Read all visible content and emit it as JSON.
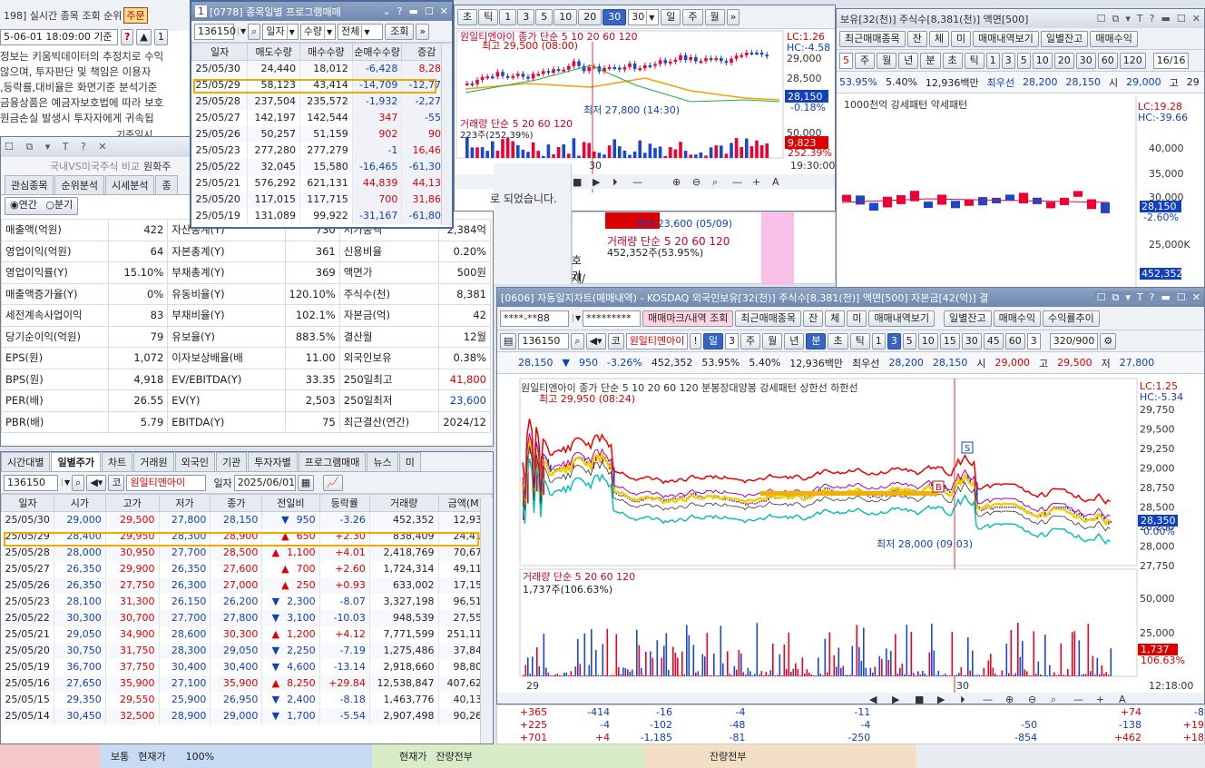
{
  "realtime": {
    "title_prefix": "198] 실시간 종목 조회 순위",
    "tab_label": "주문",
    "date_input": "5-06-01 18:09:00 기준",
    "notice": [
      "정보는 키움빅데이터의 추정치로 수익",
      "않으며, 투자판단 및 책임은 이용자",
      ",등락률,대비율은 화면기준 분석기준",
      "금융상품은 예금자보호법에 따라 보호",
      "원금손실 발생시 투자자에게 귀속됩"
    ]
  },
  "compare": {
    "title": "국내VS미국주식 비교",
    "title_suffix": "원화주",
    "tabs": [
      "관심종목",
      "순위분석",
      "시세분석",
      "종"
    ],
    "radio_annual": "연간",
    "radio_quarter": "분기",
    "rows": [
      [
        "매출액(억원)",
        "422",
        "자산총계(Y)",
        "730",
        "시가총액",
        "2,384억"
      ],
      [
        "영업이익(억원)",
        "64",
        "자본총계(Y)",
        "361",
        "신용비율",
        "0.20%"
      ],
      [
        "영업이익률(Y)",
        "15.10%",
        "부채총계(Y)",
        "369",
        "액면가",
        "500원"
      ],
      [
        "매출액증가율(Y)",
        "0%",
        "유동비율(Y)",
        "120.10%",
        "주식수(천)",
        "8,381"
      ],
      [
        "세전계속사업이익",
        "83",
        "부채비율(Y)",
        "102.1%",
        "자본금(억)",
        "42"
      ],
      [
        "당기순이익(억원)",
        "79",
        "유보율(Y)",
        "883.5%",
        "결산월",
        "12월"
      ],
      [
        "EPS(원)",
        "1,072",
        "이자보상배율(배",
        "11.00",
        "외국인보유",
        "0.38%"
      ],
      [
        "BPS(원)",
        "4,918",
        "EV/EBITDA(Y)",
        "33.35",
        "250일최고",
        "41,800"
      ],
      [
        "PER(배)",
        "26.55",
        "EV(Y)",
        "2,503",
        "250일최저",
        "23,600"
      ],
      [
        "PBR(배)",
        "5.79",
        "EBITDA(Y)",
        "75",
        "최근결산(연간)",
        "2024/12"
      ]
    ],
    "date_label": "기준일시",
    "other_label": "기"
  },
  "program": {
    "title": "[0778] 종목일별 프로그램매매",
    "code": "136150",
    "select1": "일자",
    "select2": "수량",
    "select3": "전체",
    "query": "조회",
    "headers": [
      "일자",
      "매도수량",
      "매수수량",
      "순매수수량",
      "증감"
    ],
    "rows": [
      [
        "25/05/30",
        "24,440",
        "18,012",
        "-6,428",
        "8,281"
      ],
      [
        "25/05/29",
        "58,123",
        "43,414",
        "-14,709",
        "-12,777"
      ],
      [
        "25/05/28",
        "237,504",
        "235,572",
        "-1,932",
        "-2,279"
      ],
      [
        "25/05/27",
        "142,197",
        "142,544",
        "347",
        "-555"
      ],
      [
        "25/05/26",
        "50,257",
        "51,159",
        "902",
        "903"
      ],
      [
        "25/05/23",
        "277,280",
        "277,279",
        "-1",
        "16,464"
      ],
      [
        "25/05/22",
        "32,045",
        "15,580",
        "-16,465",
        "-61,304"
      ],
      [
        "25/05/21",
        "576,292",
        "621,131",
        "44,839",
        "44,139"
      ],
      [
        "25/05/20",
        "117,015",
        "117,715",
        "700",
        "31,867"
      ],
      [
        "25/05/19",
        "131,089",
        "99,922",
        "-31,167",
        "-61,805"
      ]
    ]
  },
  "daily": {
    "tabs": [
      "시간대별",
      "일별주가",
      "차트",
      "거래원",
      "외국인",
      "기관",
      "투자자별",
      "프로그램매매",
      "뉴스",
      "미"
    ],
    "code": "136150",
    "name": "원일티엔아이",
    "date_label": "일자",
    "date": "2025/06/01",
    "headers": [
      "일자",
      "시가",
      "고가",
      "저가",
      "종가",
      "전일비",
      "등락률",
      "거래량",
      "금액(M)"
    ],
    "rows": [
      [
        "25/05/30",
        "29,000",
        "29,500",
        "27,800",
        "28,150",
        "▼",
        "950",
        "-3.26",
        "452,352",
        "12,936"
      ],
      [
        "25/05/29",
        "28,400",
        "29,950",
        "28,300",
        "28,900",
        "▲",
        "650",
        "+2.30",
        "838,409",
        "24,411"
      ],
      [
        "25/05/28",
        "28,000",
        "30,950",
        "27,700",
        "28,500",
        "▲",
        "1,100",
        "+4.01",
        "2,418,769",
        "70,679"
      ],
      [
        "25/05/27",
        "26,350",
        "29,900",
        "26,350",
        "27,600",
        "▲",
        "700",
        "+2.60",
        "1,724,314",
        "49,113"
      ],
      [
        "25/05/26",
        "26,350",
        "27,750",
        "26,300",
        "27,000",
        "▲",
        "250",
        "+0.93",
        "633,002",
        "17,153"
      ],
      [
        "25/05/23",
        "28,100",
        "31,300",
        "26,150",
        "26,200",
        "▼",
        "2,300",
        "-8.07",
        "3,327,198",
        "96,518"
      ],
      [
        "25/05/22",
        "30,300",
        "30,700",
        "27,700",
        "27,800",
        "▼",
        "3,100",
        "-10.03",
        "948,539",
        "27,557"
      ],
      [
        "25/05/21",
        "29,050",
        "34,900",
        "28,600",
        "30,300",
        "▲",
        "1,200",
        "+4.12",
        "7,771,599",
        "251,119"
      ],
      [
        "25/05/20",
        "30,750",
        "31,750",
        "28,300",
        "29,050",
        "▼",
        "2,250",
        "-7.19",
        "1,275,486",
        "37,849"
      ],
      [
        "25/05/19",
        "36,700",
        "37,750",
        "30,400",
        "30,400",
        "▼",
        "4,600",
        "-13.14",
        "2,918,660",
        "98,801"
      ],
      [
        "25/05/16",
        "27,650",
        "35,900",
        "27,100",
        "35,900",
        "▲",
        "8,250",
        "+29.84",
        "12,538,847",
        "407,626"
      ],
      [
        "25/05/15",
        "29,350",
        "29,550",
        "25,900",
        "26,950",
        "▼",
        "2,400",
        "-8.18",
        "1,463,776",
        "40,138"
      ],
      [
        "25/05/14",
        "30,450",
        "32,500",
        "28,900",
        "29,000",
        "▼",
        "1,700",
        "-5.54",
        "2,907,498",
        "90,260"
      ]
    ]
  },
  "topchart": {
    "buttons": [
      "초",
      "틱",
      "1",
      "3",
      "5",
      "10",
      "20",
      "30"
    ],
    "sel": "30",
    "period_input": "30",
    "periods": [
      "일",
      "주",
      "월"
    ],
    "legend": "원일티엔아이 종가 단순 5 10 20 60 120",
    "high_label": "최고 29,500 (08:00)",
    "low_label": "최저 27,800 (14:30)",
    "lc": "LC:1.26",
    "hc": "HC:-4.58",
    "yticks": [
      "29,000",
      "28,500",
      "28,000"
    ],
    "price_tag": "28,150",
    "pct_tag": "-0.18%",
    "vol_legend": "거래량 단순 5 20 60 120",
    "vol_val": "223주(252.39%)",
    "vol_ticks": [
      "50,000"
    ],
    "vol_tag": "9,823",
    "vol_pct": "252.39%",
    "xlabel": "30",
    "time": "19:30:00",
    "msg": "로 되었습니다."
  },
  "rightback": {
    "title": "보유[32(천)] 주식수[8,381(천)] 액면[500]",
    "btns": [
      "최근매매종목",
      "잔",
      "체",
      "미",
      "매매내역보기",
      "일별잔고",
      "매매수익"
    ],
    "input5": "5",
    "periods": [
      "주",
      "월",
      "년",
      "분",
      "초",
      "틱"
    ],
    "nums": [
      "1",
      "3",
      "5",
      "10",
      "20",
      "30",
      "60",
      "120"
    ],
    "page": "16/16",
    "info": [
      "53.95%",
      "5.40%",
      "12,936백만",
      "최우선",
      "28,200",
      "28,150",
      "시",
      "29,000",
      "고",
      "29"
    ],
    "chart_legend": "1000천억 강세패턴 약세패턴",
    "lc": "LC:19.28",
    "hc": "HC:-39.66",
    "yticks": [
      "40,000",
      "35,000",
      "30,000",
      "25,000K"
    ],
    "tag": "28,150",
    "pct": "-2.60%",
    "low": "최저 23,600 (05/09)",
    "vol_legend": "거래량 단순 5 20 60 120",
    "vol_val": "452,352주(53.95%)",
    "vol_tag": "452,352",
    "side": [
      "호가",
      "재/"
    ]
  },
  "autochart": {
    "title": "[0606] 자동일지차트(매매내역) - KOSDAQ 외국인보유[32(천)] 주식수[8,381(천)] 액면[500] 자본금[42(억)] 결",
    "account": "****-**88",
    "password": "*********",
    "btns": [
      "매매마크/내역 조회",
      "최근매매종목",
      "잔",
      "체",
      "미",
      "매매내역보기",
      "일별잔고",
      "매매수익",
      "수익률추이"
    ],
    "code": "136150",
    "name": "원일티엔아이",
    "day": "일",
    "d3": "3",
    "periods": [
      "주",
      "월",
      "년",
      "분",
      "초",
      "틱"
    ],
    "nums": [
      "1",
      "3",
      "5",
      "10",
      "15",
      "30",
      "45",
      "60"
    ],
    "n3": "3",
    "page": "320/900",
    "info": [
      "28,150",
      "▼",
      "950",
      "-3.26%",
      "452,352",
      "53.95%",
      "5.40%",
      "12,936백만",
      "최우선",
      "28,200",
      "28,150",
      "시",
      "29,000",
      "고",
      "29,500",
      "저",
      "27,800"
    ],
    "legend": "원일티엔아이 종가 단순 5 10 20 60 120 분봉장대양봉 강세패턴 상한선 하한선",
    "lc": "LC:1.25",
    "hc": "HC:-5.34",
    "high_label": "최고 29,950 (08:24)",
    "low_label": "최저 28,000 (09:03)",
    "yticks": [
      "29,750",
      "29,500",
      "29,250",
      "29,000",
      "28,750",
      "28,500",
      "28,250",
      "28,000",
      "27,750"
    ],
    "price_tag": "28,350",
    "pct_tag": "0.00%",
    "vol_legend": "거래량 단순 5 20 60 120",
    "vol_val": "1,737주(106.63%)",
    "vol_ticks": [
      "50,000",
      "25,000"
    ],
    "vol_tag": "1,737",
    "vol_pct": "106.63%",
    "x1": "29",
    "x2": "30",
    "time": "12:18:00",
    "markB": "B",
    "markS": "S"
  },
  "bottomrows": [
    [
      "+365",
      "-414",
      "-16",
      "-4",
      "-11",
      "",
      "+74",
      "-8"
    ],
    [
      "+225",
      "-4",
      "-102",
      "-48",
      "-4",
      "-50",
      "-138",
      "+19"
    ],
    [
      "+701",
      "+4",
      "-1,185",
      "-81",
      "-250",
      "-854",
      "+462",
      "+18"
    ]
  ],
  "status": [
    "보통",
    "현재가",
    "100%",
    "현재가",
    "잔량전부",
    "잔량전부"
  ]
}
